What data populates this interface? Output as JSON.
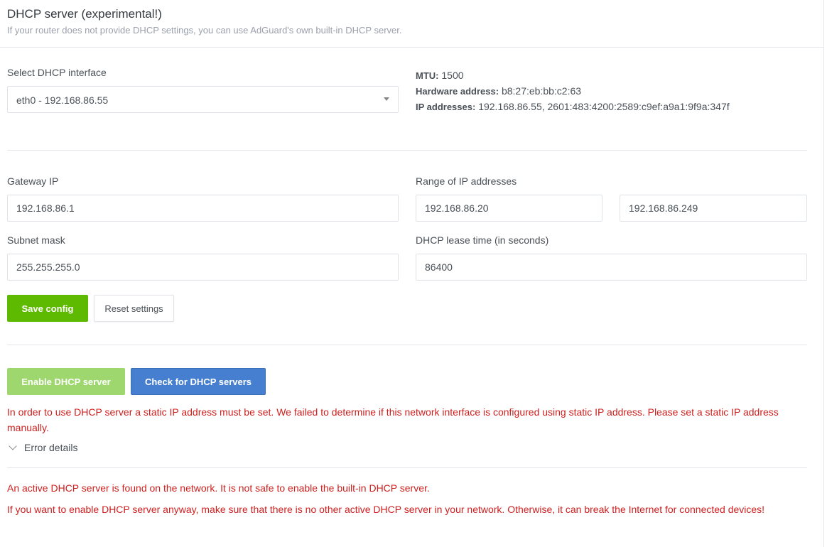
{
  "header": {
    "title": "DHCP server (experimental!)",
    "subtitle": "If your router does not provide DHCP settings, you can use AdGuard's own built-in DHCP server."
  },
  "interface": {
    "label": "Select DHCP interface",
    "selected": "eth0 - 192.168.86.55",
    "mtu_label": "MTU:",
    "mtu_value": "1500",
    "hw_label": "Hardware address:",
    "hw_value": "b8:27:eb:bb:c2:63",
    "ip_label": "IP addresses:",
    "ip_value": "192.168.86.55, 2601:483:4200:2589:c9ef:a9a1:9f9a:347f"
  },
  "form": {
    "gateway_label": "Gateway IP",
    "gateway_value": "192.168.86.1",
    "range_label": "Range of IP addresses",
    "range_start": "192.168.86.20",
    "range_end": "192.168.86.249",
    "subnet_label": "Subnet mask",
    "subnet_value": "255.255.255.0",
    "lease_label": "DHCP lease time (in seconds)",
    "lease_value": "86400"
  },
  "buttons": {
    "save": "Save config",
    "reset": "Reset settings",
    "enable": "Enable DHCP server",
    "check": "Check for DHCP servers"
  },
  "messages": {
    "static_ip_error": "In order to use DHCP server a static IP address must be set. We failed to determine if this network interface is configured using static IP address. Please set a static IP address manually.",
    "error_details": "Error details",
    "active_found": "An active DHCP server is found on the network. It is not safe to enable the built-in DHCP server.",
    "warning": "If you want to enable DHCP server anyway, make sure that there is no other active DHCP server in your network. Otherwise, it can break the Internet for connected devices!"
  },
  "colors": {
    "green": "#5eba00",
    "blue": "#467fcf",
    "error": "#cd201f"
  }
}
